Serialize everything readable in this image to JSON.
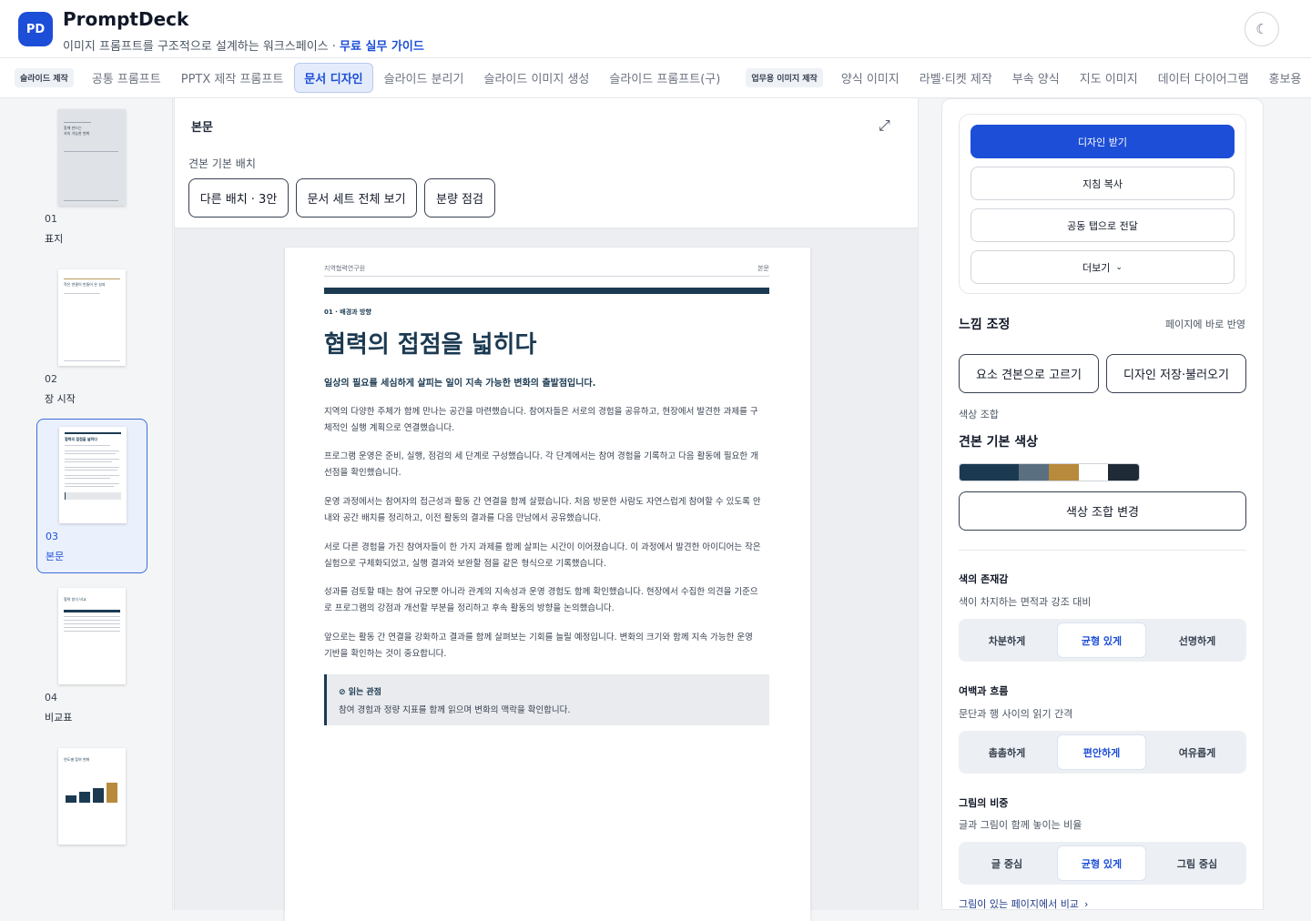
{
  "header": {
    "logo_text": "PD",
    "brand": "PromptDeck",
    "tagline": "이미지 프롬프트를 구조적으로 설계하는 워크스페이스 · ",
    "tagline_link": "무료 실무 가이드",
    "theme_glyph": "☾"
  },
  "tabs": {
    "group1_label": "슬라이드 제작",
    "group1": [
      "공통 프롬프트",
      "PPTX 제작 프롬프트",
      "문서 디자인",
      "슬라이드 분리기",
      "슬라이드 이미지 생성",
      "슬라이드 프롬프트(구)"
    ],
    "active": "문서 디자인",
    "group2_label": "업무용 이미지 제작",
    "group2": [
      "양식 이미지",
      "라벨·티켓 제작",
      "부속 양식",
      "지도 이미지",
      "데이터 다이어그램",
      "홍보용"
    ]
  },
  "thumbnails": [
    {
      "num": "01",
      "label": "표지",
      "mini_title": "함께 만드는\n지속 가능한 변화"
    },
    {
      "num": "02",
      "label": "장 시작",
      "mini_title": "작은 연결이 만들어 온 성과"
    },
    {
      "num": "03",
      "label": "본문",
      "mini_title": "협력의 접점을 넓히다",
      "active": true
    },
    {
      "num": "04",
      "label": "비교표",
      "mini_title": "협력 방식 비교"
    },
    {
      "num": "05",
      "label": "차트",
      "mini_title": "연도별 참여 변화"
    }
  ],
  "center": {
    "title": "본문",
    "layout_label": "견본 기본 배치",
    "buttons": [
      "다른 배치 · 3안",
      "문서 세트 전체 보기",
      "분량 점검"
    ]
  },
  "document": {
    "org": "지역협력연구원",
    "section": "본문",
    "kicker": "01 · 배경과 방향",
    "title": "협력의 접점을 넓히다",
    "lead": "일상의 필요를 세심하게 살피는 일이 지속 가능한 변화의 출발점입니다.",
    "paragraphs": [
      "지역의 다양한 주체가 함께 만나는 공간을 마련했습니다. 참여자들은 서로의 경험을 공유하고, 현장에서 발견한 과제를 구체적인 실행 계획으로 연결했습니다.",
      "프로그램 운영은 준비, 실행, 점검의 세 단계로 구성했습니다. 각 단계에서는 참여 경험을 기록하고 다음 활동에 필요한 개선점을 확인했습니다.",
      "운영 과정에서는 참여자의 접근성과 활동 간 연결을 함께 살폈습니다. 처음 방문한 사람도 자연스럽게 참여할 수 있도록 안내와 공간 배치를 정리하고, 이전 활동의 결과를 다음 만남에서 공유했습니다.",
      "서로 다른 경험을 가진 참여자들이 한 가지 과제를 함께 살피는 시간이 이어졌습니다. 이 과정에서 발견한 아이디어는 작은 실험으로 구체화되었고, 실행 결과와 보완할 점을 같은 형식으로 기록했습니다.",
      "성과를 검토할 때는 참여 규모뿐 아니라 관계의 지속성과 운영 경험도 함께 확인했습니다. 현장에서 수집한 의견을 기준으로 프로그램의 강점과 개선할 부분을 정리하고 후속 활동의 방향을 논의했습니다.",
      "앞으로는 활동 간 연결을 강화하고 결과를 함께 살펴보는 기회를 늘릴 예정입니다. 변화의 크기와 함께 지속 가능한 운영 기반을 확인하는 것이 중요합니다."
    ],
    "note_title": "읽는 관점",
    "note_body": "참여 경험과 정량 지표를 함께 읽으며 변화의 맥락을 확인합니다."
  },
  "panel": {
    "primary": "디자인 받기",
    "copy": "지침 복사",
    "send": "공동 탭으로 전달",
    "more": "더보기",
    "feel_title": "느낌 조정",
    "feel_note": "페이지에 바로 반영",
    "pick_btn": "요소 견본으로 고르기",
    "save_btn": "디자인 저장·불러오기",
    "color_label": "색상 조합",
    "color_title": "견본 기본 색상",
    "swatches": [
      "#1b3a52",
      "#5a7080",
      "#b88a3b",
      "#ffffff",
      "#1e2a36"
    ],
    "change_color": "색상 조합 변경",
    "groups": [
      {
        "title": "색의 존재감",
        "desc": "색이 차지하는 면적과 강조 대비",
        "options": [
          "차분하게",
          "균형 있게",
          "선명하게"
        ],
        "selected": 1
      },
      {
        "title": "여백과 흐름",
        "desc": "문단과 행 사이의 읽기 간격",
        "options": [
          "촘촘하게",
          "편안하게",
          "여유롭게"
        ],
        "selected": 1
      },
      {
        "title": "그림의 비중",
        "desc": "글과 그림이 함께 놓이는 비율",
        "options": [
          "글 중심",
          "균형 있게",
          "그림 중심"
        ],
        "selected": 1
      }
    ],
    "compare_link": "그림이 있는 페이지에서 비교"
  }
}
